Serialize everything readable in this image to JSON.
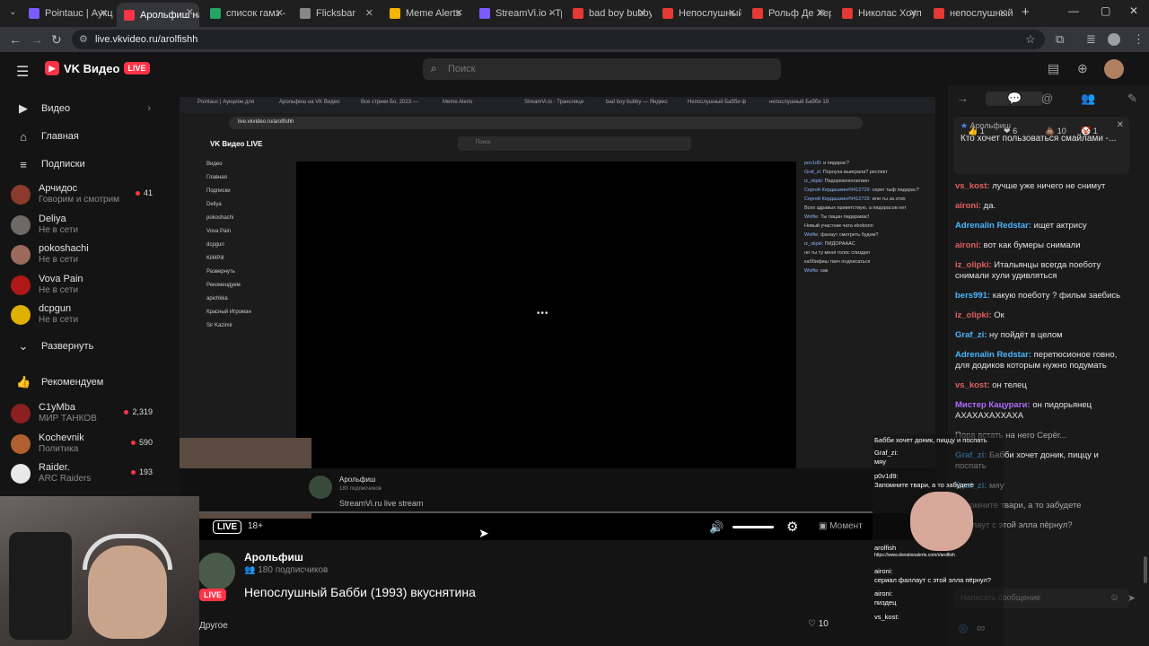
{
  "browser": {
    "tabs": [
      {
        "title": "Pointauc | Аукцион",
        "color": "#7a5cff",
        "active": false
      },
      {
        "title": "Арольфиш на",
        "color": "#ff3347",
        "active": true
      },
      {
        "title": "список гамз -",
        "color": "#23a566",
        "active": false
      },
      {
        "title": "Flicksbar",
        "color": "#888888",
        "active": false
      },
      {
        "title": "Meme Alerts",
        "color": "#f5b400",
        "active": false
      },
      {
        "title": "StreamVi.io - Тр",
        "color": "#7b5cff",
        "active": false
      },
      {
        "title": "bad boy bubby",
        "color": "#e53935",
        "active": false
      },
      {
        "title": "Непослушный",
        "color": "#e53935",
        "active": false
      },
      {
        "title": "Рольф Де Хер",
        "color": "#e53935",
        "active": false
      },
      {
        "title": "Николас Хоуп",
        "color": "#e53935",
        "active": false
      },
      {
        "title": "непослушный",
        "color": "#e53935",
        "active": false
      }
    ],
    "url": "live.vkvideo.ru/arolfishh"
  },
  "header": {
    "logo_text": "VK Видео",
    "logo_badge": "LIVE",
    "search_placeholder": "Поиск"
  },
  "sidebar": {
    "nav": [
      {
        "label": "Видео",
        "icon": "▶",
        "chevron": "›"
      },
      {
        "label": "Главная",
        "icon": "⌂",
        "chevron": ""
      },
      {
        "label": "Подписки",
        "icon": "≡",
        "chevron": ""
      }
    ],
    "subscriptions": [
      {
        "name": "Арчидос",
        "status": "Говорим и смотрим",
        "count": "41",
        "color": "#8a3b2b"
      },
      {
        "name": "Deliya",
        "status": "Не в сети",
        "count": "",
        "color": "#6d6a66"
      },
      {
        "name": "pokoshachi",
        "status": "Не в сети",
        "count": "",
        "color": "#9b6a5a"
      },
      {
        "name": "Vova Pain",
        "status": "Не в сети",
        "count": "",
        "color": "#b01818"
      },
      {
        "name": "dcpgun",
        "status": "Не в сети",
        "count": "",
        "color": "#e0b000"
      }
    ],
    "expand_label": "Развернуть",
    "recommend_label": "Рекомендуем",
    "recommended": [
      {
        "name": "C1yMba",
        "status": "МИР ТАНКОВ",
        "count": "2,319",
        "color": "#8a2020"
      },
      {
        "name": "Kochevnik",
        "status": "Политика",
        "count": "590",
        "color": "#b06030"
      },
      {
        "name": "Raider.",
        "status": "ARC Raiders",
        "count": "193",
        "color": "#e8e8e8"
      }
    ]
  },
  "inner_stream": {
    "tabs": [
      "Pointauc | Аукцион для",
      "Арольфиш на VK Видео",
      "Все стрики Бо, 2023 —",
      "Meme Alerts",
      "StreamVi.io - Трансляци",
      "bad boy bubby — Яндекс",
      "Непослушный Бабби ф",
      "непослушный Бабби 19"
    ],
    "url": "live.vkvideo.ru/arolfishh",
    "logo": "VK Видео LIVE",
    "search": "Поиск",
    "side": [
      "Видео",
      "Главная",
      "Подписки",
      "Deliya",
      "pokoshachi",
      "Vova Pain",
      "dcpgun",
      "Kill4Pill",
      "Развернуть",
      "Рекомендуем",
      "apichkka",
      "Красный Игроман",
      "Sir Kazimir"
    ],
    "chat": [
      {
        "u": "pov1d9:",
        "t": "и пидарас?"
      },
      {
        "u": "Graf_zi:",
        "t": "Порнуха выиграла? респект"
      },
      {
        "u": "iz_olipki:",
        "t": "Педорюкоеноигиин"
      },
      {
        "u": "Сергей Кердашкин#9412729:",
        "t": "серег тыф пидарас?"
      },
      {
        "u": "Сергей Кердашкин#9412729:",
        "t": "или ты за этих"
      },
      {
        "u": "",
        "t": "Всех здравых приветствую, а пидорасов нет"
      },
      {
        "u": "Wolfie:",
        "t": "Ты пацан пидаравас!"
      },
      {
        "u": "",
        "t": "Новый участник чата ebobonn"
      },
      {
        "u": "Wolfie:",
        "t": "фалаут смотреть будем?"
      },
      {
        "u": "iz_olipki:",
        "t": "ПИДОРАААС"
      },
      {
        "u": "",
        "t": "но ты ту меня голос спиздил"
      },
      {
        "u": "",
        "t": "каббифиш твич подписаться"
      },
      {
        "u": "Wolfie:",
        "t": "как"
      }
    ],
    "channel": "Арольфиш",
    "subs": "180 подписчиков",
    "title": "StreamVi.ru live stream"
  },
  "player": {
    "live_label": "LIVE",
    "age_label": "18+",
    "moment_label": "Момент",
    "volume": 1.0
  },
  "channel": {
    "name": "Арольфиш",
    "subscribers": "180 подписчиков",
    "title": "Непослушный Бабби (1993) вкуснятина",
    "live_badge": "LIVE",
    "other_label": "Другое",
    "likes": "10"
  },
  "chat": {
    "pinned_author": "Арольфиш",
    "pinned_text": "Кто хочет пользоваться смайлами -...",
    "reactions": [
      {
        "emoji": "👍",
        "count": "1"
      },
      {
        "emoji": "❤",
        "count": "6"
      },
      {
        "emoji": "💩",
        "count": "10"
      },
      {
        "emoji": "🤡",
        "count": "1"
      }
    ],
    "messages": [
      {
        "user": "vs_kost:",
        "text": "лучше уже ничего не снимут",
        "color": "#e06060"
      },
      {
        "user": "aironi:",
        "text": "да.",
        "color": "#e06060"
      },
      {
        "user": "Adrenalin Redstar:",
        "text": "ищет актрису",
        "color": "#4ab5ff"
      },
      {
        "user": "aironi:",
        "text": "вот как бумеры снимали",
        "color": "#e06060"
      },
      {
        "user": "iz_olipki:",
        "text": "Итальянцы всегда поеботу снимали хули удивляться",
        "color": "#e06060"
      },
      {
        "user": "bers991:",
        "text": "какую поеботу ? фильм заебись",
        "color": "#4ab5ff"
      },
      {
        "user": "iz_olipki:",
        "text": "Ок",
        "color": "#e06060"
      },
      {
        "user": "Graf_zi:",
        "text": "ну пойдёт в целом",
        "color": "#4ab5ff"
      },
      {
        "user": "Adrenalin Redstar:",
        "text": "перетюсионое говно, для додиков которым нужно подумать",
        "color": "#4ab5ff"
      },
      {
        "user": "vs_kost:",
        "text": "он телец",
        "color": "#e06060"
      },
      {
        "user": "Мистер Кацураги:",
        "text": "он пидорьянец АХАХАХАХХАХА",
        "color": "#b06aff"
      },
      {
        "user": "",
        "text": "Пора встать на него Серёг...",
        "color": "#aaaaaa"
      },
      {
        "user": "Graf_zi:",
        "text": "Бабби хочет доник, пиццу и поспать",
        "color": "#4ab5ff"
      },
      {
        "user": "Graf_zi:",
        "text": "мяу",
        "color": "#4ab5ff"
      },
      {
        "user": "",
        "text": "Запомните твари, а то забудете",
        "color": "#aaaaaa"
      },
      {
        "user": "",
        "text": "фаллаут с этой элла пёрнул?",
        "color": "#aaaaaa"
      }
    ],
    "input_placeholder": "Написать сообщение"
  },
  "alert_overlay": {
    "lines": [
      "Бабби хочет доник, пиццу и поспать",
      "Graf_zi:",
      "мяу",
      "p0v1d9:",
      "Запомните твари, а то забудете",
      "arolfish",
      "https://www.donationalerts.com/r/arolfish",
      "aironi:",
      "сериал фаллаут с этой элла пёрнул?",
      "aironi:",
      "пиздец",
      "vs_kost:"
    ]
  }
}
